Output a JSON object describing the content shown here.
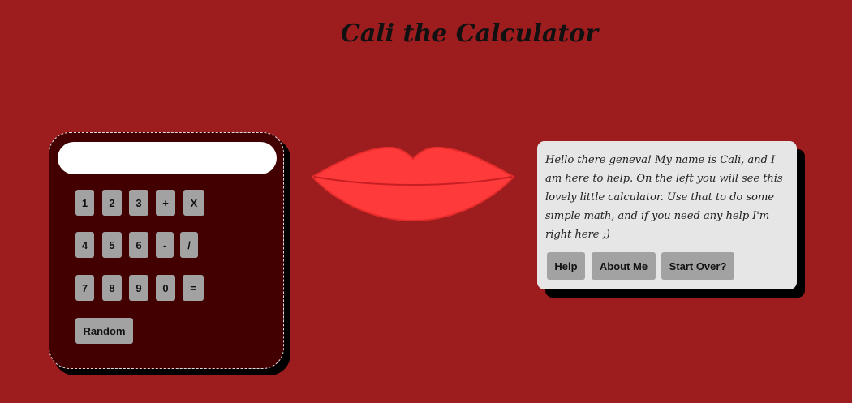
{
  "title": "Cali the Calculator",
  "calculator": {
    "display_value": "",
    "rows": [
      [
        "1",
        "2",
        "3",
        "+",
        "X"
      ],
      [
        "4",
        "5",
        "6",
        "-",
        "/"
      ],
      [
        "7",
        "8",
        "9",
        "0",
        "="
      ]
    ],
    "random_label": "Random"
  },
  "speech": {
    "message": "Hello there geneva! My name is Cali, and I am here to help. On the left you will see this lovely little calculator. Use that to do some simple math, and if you need any help I'm right here ;)",
    "buttons": {
      "help": "Help",
      "about": "About Me",
      "start_over": "Start Over?"
    }
  },
  "colors": {
    "background": "#9d1d1f",
    "calculator_body": "#430000",
    "key": "#a2a2a2",
    "lips": "#ff3a3a",
    "speech_box": "#e6e6e6"
  }
}
